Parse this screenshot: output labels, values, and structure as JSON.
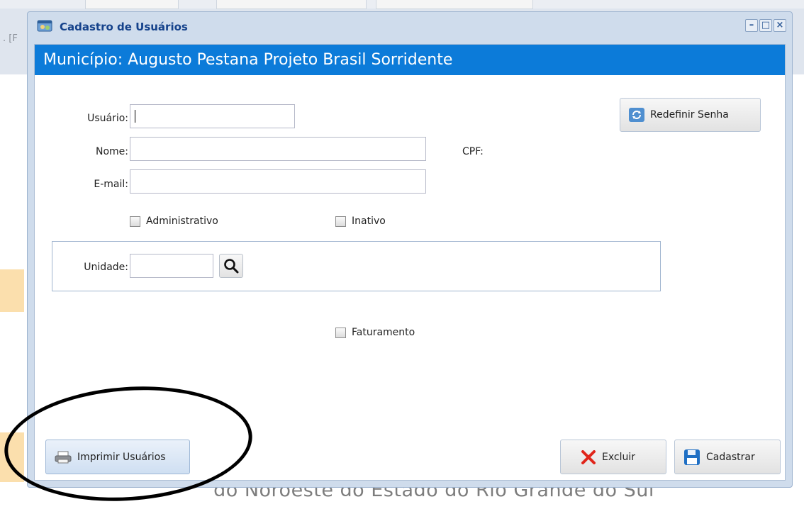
{
  "background": {
    "left_text": ". [F",
    "footer_text": "do Noroeste do Estado do Rio Grande do Sul"
  },
  "dialog": {
    "title": "Cadastro de Usuários",
    "header": "Município: Augusto Pestana Projeto Brasil Sorridente",
    "window_buttons": {
      "minimize": "–",
      "maximize": "□",
      "close": "×"
    },
    "form": {
      "usuario_label": "Usuário:",
      "usuario_value": "",
      "nome_label": "Nome:",
      "nome_value": "",
      "email_label": "E-mail:",
      "email_value": "",
      "cpf_label": "CPF:",
      "administrativo_label": "Administrativo",
      "inativo_label": "Inativo",
      "unidade_label": "Unidade:",
      "unidade_value": "",
      "faturamento_label": "Faturamento"
    },
    "buttons": {
      "redefinir_senha": "Redefinir Senha",
      "imprimir_usuarios": "Imprimir Usuários",
      "excluir": "Excluir",
      "cadastrar": "Cadastrar"
    }
  },
  "colors": {
    "header_band": "#0c7bd9",
    "title_text": "#15428b",
    "dialog_frame": "#cfdcec",
    "delete_icon": "#e0251b",
    "save_icon": "#1f6fc4"
  },
  "icons": {
    "title": "users-window-icon",
    "redefinir": "refresh-icon",
    "search": "search-icon",
    "imprimir": "printer-icon",
    "excluir": "x-delete-icon",
    "cadastrar": "floppy-save-icon"
  }
}
